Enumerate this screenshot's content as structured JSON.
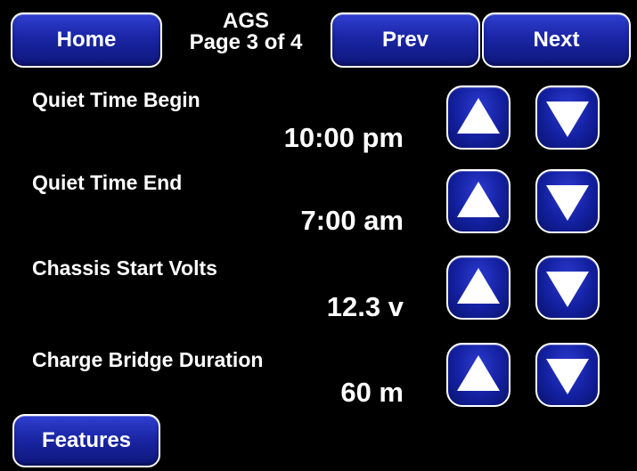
{
  "header": {
    "home_label": "Home",
    "title": "AGS",
    "page_indicator": "Page 3 of 4",
    "prev_label": "Prev",
    "next_label": "Next"
  },
  "settings": [
    {
      "label": "Quiet Time Begin",
      "value": "10:00 pm"
    },
    {
      "label": "Quiet Time End",
      "value": "7:00 am"
    },
    {
      "label": "Chassis Start Volts",
      "value": "12.3 v"
    },
    {
      "label": "Charge Bridge Duration",
      "value": "60 m"
    }
  ],
  "footer": {
    "features_label": "Features"
  },
  "icons": {
    "increase": "arrow-up-icon",
    "decrease": "arrow-down-icon"
  },
  "colors": {
    "background": "#000000",
    "button_blue": "#1a26a6",
    "border": "#ffffff",
    "text": "#ffffff"
  }
}
